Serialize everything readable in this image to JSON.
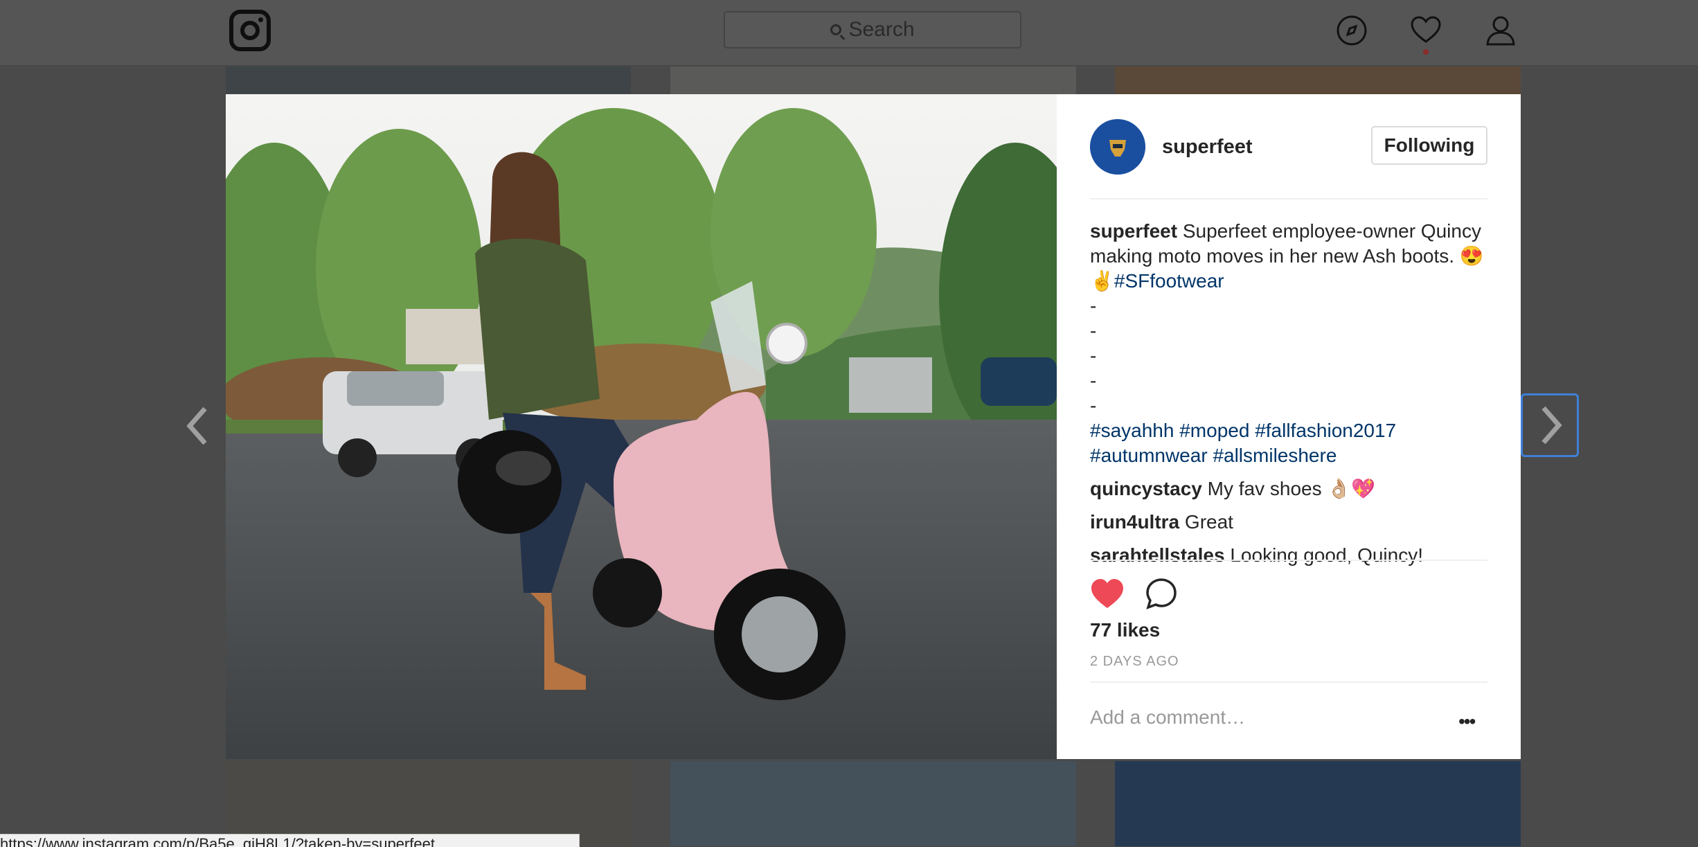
{
  "topbar": {
    "search_placeholder": "Search",
    "icons": [
      "instagram-logo-icon",
      "search-icon",
      "explore-compass-icon",
      "heart-icon",
      "profile-icon"
    ]
  },
  "post": {
    "username": "superfeet",
    "follow_label": "Following",
    "caption": {
      "author": "superfeet",
      "text": "Superfeet employee-owner Quincy making moto moves in her new Ash boots. 😍✌",
      "hashtag_inline": "#SFfootwear",
      "dashes": [
        "-",
        "-",
        "-",
        "-",
        "-"
      ],
      "hashtags_line1": [
        "#sayahhh",
        "#moped",
        "#fallfashion2017"
      ],
      "hashtags_line2": [
        "#autumnwear",
        "#allsmileshere"
      ]
    },
    "comments": [
      {
        "author": "quincystacy",
        "text": "My fav shoes 👌🏼💖"
      },
      {
        "author": "irun4ultra",
        "text": "Great"
      },
      {
        "author": "sarahtellstales",
        "text": "Looking good, Quincy!"
      }
    ],
    "liked": true,
    "likes": "77 likes",
    "timestamp": "2 DAYS AGO",
    "add_comment_placeholder": "Add a comment…",
    "more_label": "•••"
  },
  "status_bar_url": "https://www.instagram.com/p/Ba5e_qjH8L1/?taken-by=superfeet",
  "colors": {
    "like": "#ed4956",
    "link": "#003569",
    "overlay": "#4a4a4a"
  }
}
